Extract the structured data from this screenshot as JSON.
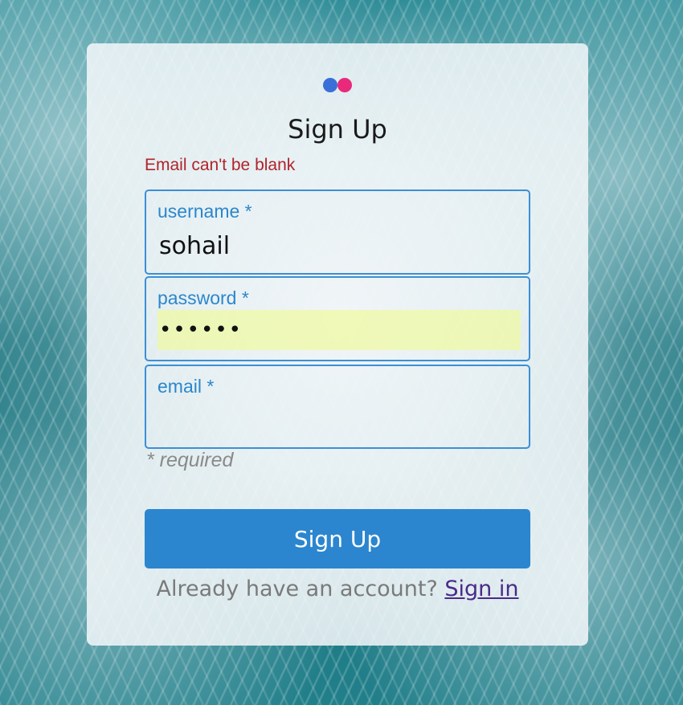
{
  "logo": {
    "icon": "flickr-logo-icon",
    "colors": {
      "left_dot": "#3a6fd8",
      "right_dot": "#e8297c"
    }
  },
  "form": {
    "title": "Sign Up",
    "error_message": "Email can't be blank",
    "fields": [
      {
        "label": "username *",
        "value": "sohail",
        "type": "text"
      },
      {
        "label": "password *",
        "value": "••••••",
        "type": "password"
      },
      {
        "label": "email *",
        "value": "",
        "type": "email"
      }
    ],
    "required_note": "* required",
    "submit_label": "Sign Up"
  },
  "footer": {
    "prompt": "Already have an account?",
    "link_label": "Sign in"
  },
  "colors": {
    "accent": "#2b86cf",
    "error": "#b0242a",
    "link": "#4a2a8a",
    "autofill": "#f0fa96"
  }
}
